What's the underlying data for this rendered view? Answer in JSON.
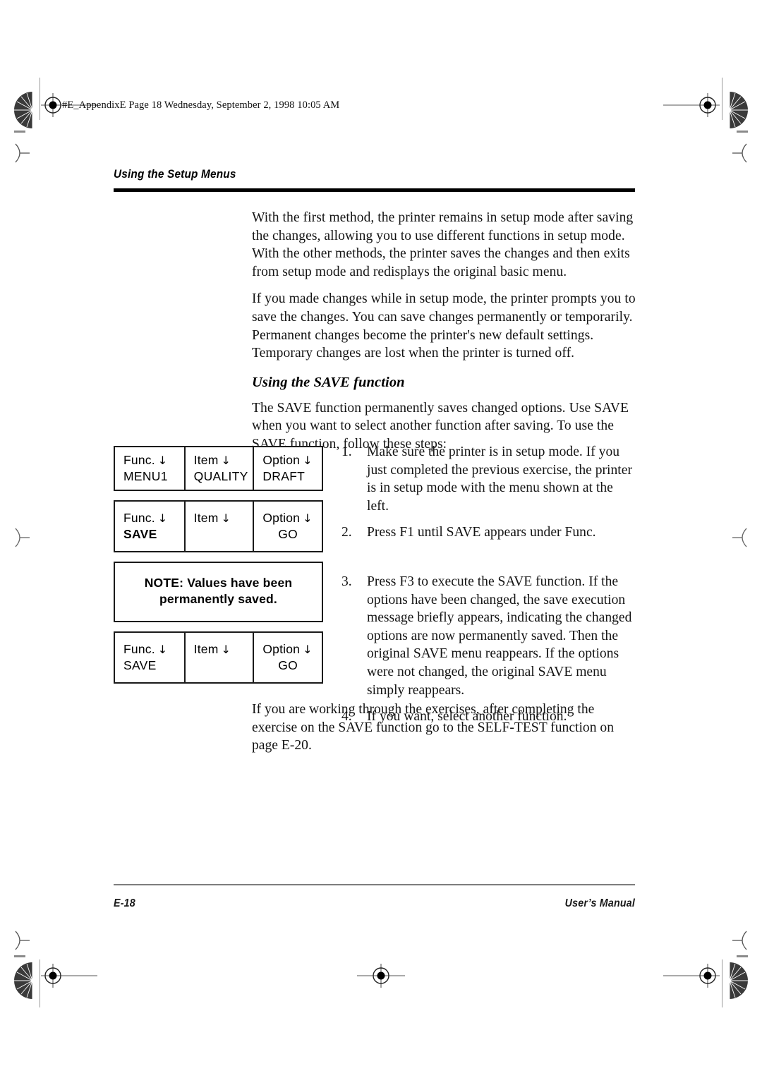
{
  "slug": {
    "text": "#E_AppendixE  Page 18  Wednesday, September 2, 1998  10:05 AM"
  },
  "running_head": {
    "title": "Using the Setup Menus"
  },
  "body": {
    "paragraph_1": "With the first method, the printer remains in setup mode after saving the changes, allowing you to use different functions in setup mode. With the other methods, the printer saves the changes and then exits from setup mode and redisplays the original basic menu.",
    "paragraph_2": "If you made changes while in setup mode, the printer prompts you to save the changes. You can save changes permanently or temporarily. Permanent changes become the printer's new default settings. Temporary changes are lost when the printer is turned off.",
    "subheading": "Using the SAVE function",
    "paragraph_3": "The SAVE function permanently saves changed options. Use SAVE when you want to select another function after saving. To use the SAVE function, follow these steps:",
    "closing_paragraph": "If you are working through the exercises, after completing the exercise on the SAVE function go to the SELF-TEST function on page E-20."
  },
  "steps": [
    {
      "number": "1.",
      "text": "Make sure the printer is in setup mode. If you just completed the previous exercise, the printer is in setup mode with the menu shown at the left."
    },
    {
      "number": "2.",
      "text": "Press F1 until SAVE appears under Func."
    },
    {
      "number": "3.",
      "text": "Press F3 to execute the SAVE function. If the options have been changed, the save execution message briefly appears, indicating the changed options are now permanently saved. Then the original SAVE menu reappears. If the options were not changed, the original SAVE menu simply reappears."
    },
    {
      "number": "4.",
      "text": "If you want, select another function."
    }
  ],
  "panels": {
    "arrow_glyph": "↓",
    "panel_1": {
      "func_label": "Func.",
      "func_value": "MENU1",
      "item_label": "Item",
      "item_value": "QUALITY",
      "option_label": "Option",
      "option_value": "DRAFT"
    },
    "panel_2": {
      "func_label": "Func.",
      "func_value": "SAVE",
      "item_label": "Item",
      "item_value": "",
      "option_label": "Option",
      "option_value": "GO"
    },
    "note": {
      "line_1": "NOTE: Values have been",
      "line_2": "permanently saved."
    },
    "panel_3": {
      "func_label": "Func.",
      "func_value": "SAVE",
      "item_label": "Item",
      "item_value": "",
      "option_label": "Option",
      "option_value": "GO"
    }
  },
  "footer": {
    "page_number": "E-18",
    "manual_title": "User’s Manual"
  }
}
